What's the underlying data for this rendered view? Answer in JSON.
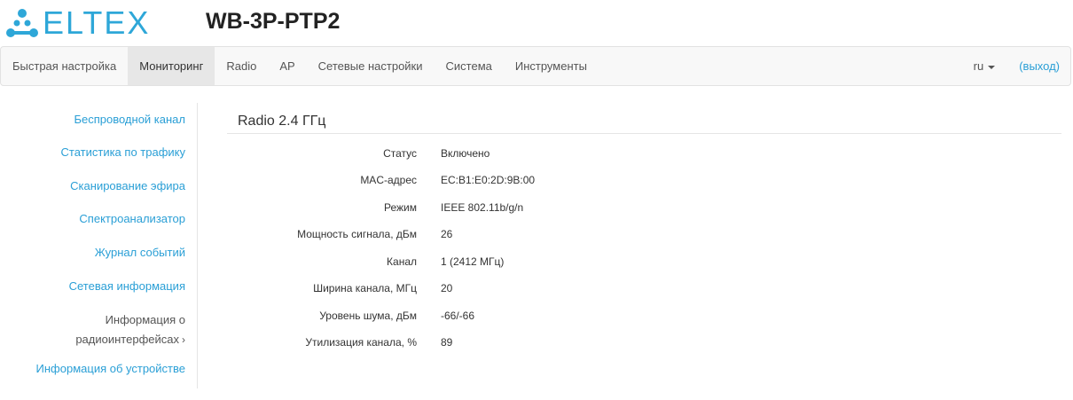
{
  "brand": {
    "logo_text": "ELTEX",
    "logo_color": "#2ea7d8"
  },
  "device": {
    "title": "WB-3P-PTP2"
  },
  "nav": {
    "items": [
      {
        "label": "Быстрая настройка"
      },
      {
        "label": "Мониторинг",
        "active": true
      },
      {
        "label": "Radio"
      },
      {
        "label": "AP"
      },
      {
        "label": "Сетевые настройки"
      },
      {
        "label": "Система"
      },
      {
        "label": "Инструменты"
      }
    ],
    "language": "ru",
    "logout": "(выход)"
  },
  "sidebar": {
    "items": [
      {
        "label": "Беспроводной канал"
      },
      {
        "label": "Статистика по трафику"
      },
      {
        "label": "Сканирование эфира"
      },
      {
        "label": "Спектроанализатор"
      },
      {
        "label": "Журнал событий"
      },
      {
        "label": "Сетевая информация"
      },
      {
        "label_line1": "Информация о",
        "label_line2": "радиоинтерфейсах",
        "active": true,
        "icon": "chevron-right-icon"
      },
      {
        "label": "Информация об устройстве"
      }
    ]
  },
  "main": {
    "section_title": "Radio 2.4 ГГц",
    "rows": [
      {
        "label": "Статус",
        "value": "Включено"
      },
      {
        "label": "MAC-адрес",
        "value": "EC:B1:E0:2D:9B:00"
      },
      {
        "label": "Режим",
        "value": "IEEE 802.11b/g/n"
      },
      {
        "label": "Мощность сигнала, дБм",
        "value": "26"
      },
      {
        "label": "Канал",
        "value": "1 (2412 МГц)"
      },
      {
        "label": "Ширина канала, МГц",
        "value": "20"
      },
      {
        "label": "Уровень шума, дБм",
        "value": "-66/-66"
      },
      {
        "label": "Утилизация канала, %",
        "value": "89"
      }
    ]
  },
  "colors": {
    "link": "#2a9fd6",
    "nav_active_bg": "#e7e7e7",
    "navbar_bg": "#f8f8f8"
  }
}
